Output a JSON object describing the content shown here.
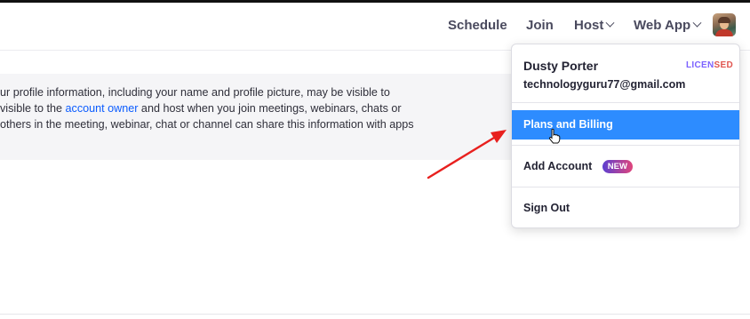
{
  "nav": {
    "schedule": "Schedule",
    "join": "Join",
    "host": "Host",
    "web_app": "Web App"
  },
  "notice": {
    "line1": "ur profile information, including your name and profile picture, may be visible to",
    "line2_pre": " visible to the ",
    "line2_link": "account owner",
    "line2_post": " and host when you join meetings, webinars, chats or",
    "line3": "others in the meeting, webinar, chat or channel can share this information with apps"
  },
  "dropdown": {
    "user_name": "Dusty Porter",
    "license_part1": "LICEN",
    "license_part2": "SED",
    "email": "technologyguru77@gmail.com",
    "plans_billing": "Plans and Billing",
    "add_account": "Add Account",
    "new_badge": "NEW",
    "sign_out": "Sign Out"
  },
  "colors": {
    "highlight": "#2d8cff",
    "link": "#0b5cff",
    "annotation_arrow": "#e8201e"
  },
  "icons": [
    "chevron-down-icon",
    "avatar",
    "hand-cursor-icon",
    "annotation-arrow"
  ]
}
